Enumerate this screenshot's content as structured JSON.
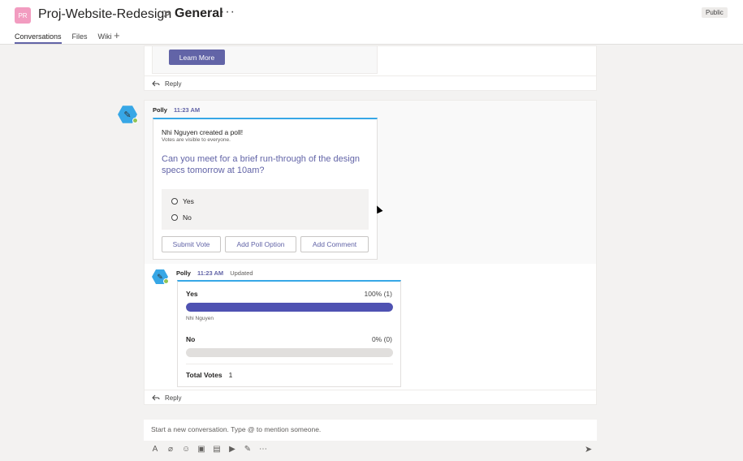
{
  "header": {
    "team_initials": "PR",
    "team_name": "Proj-Website-Redesign",
    "separator": ">",
    "channel_name": "General",
    "more": "···",
    "visibility": "Public",
    "tabs": [
      {
        "label": "Conversations",
        "active": true
      },
      {
        "label": "Files",
        "active": false
      },
      {
        "label": "Wiki",
        "active": false
      }
    ],
    "add_tab": "+"
  },
  "thread1": {
    "learn_more": "Learn More",
    "reply": "Reply"
  },
  "poll": {
    "sender": "Polly",
    "time": "11:23 AM",
    "creator_text": "Nhi Nguyen created a poll!",
    "visibility_note": "Votes are visible to everyone.",
    "question": "Can you meet for a brief run-through of the design specs tomorrow at 10am?",
    "options": [
      "Yes",
      "No"
    ],
    "buttons": {
      "submit": "Submit Vote",
      "add_option": "Add Poll Option",
      "add_comment": "Add Comment"
    }
  },
  "results": {
    "sender": "Polly",
    "time": "11:23 AM",
    "status": "Updated",
    "rows": [
      {
        "label": "Yes",
        "pct": "100% (1)",
        "fraction": 1.0,
        "voters": "Nhi Nguyen"
      },
      {
        "label": "No",
        "pct": "0% (0)",
        "fraction": 0.0,
        "voters": ""
      }
    ],
    "total_label": "Total Votes",
    "total_value": "1",
    "reply": "Reply"
  },
  "compose": {
    "placeholder": "Start a new conversation. Type @ to mention someone."
  },
  "colors": {
    "accent": "#6264a7",
    "poll_border": "#37a7e6",
    "online": "#92c353"
  }
}
